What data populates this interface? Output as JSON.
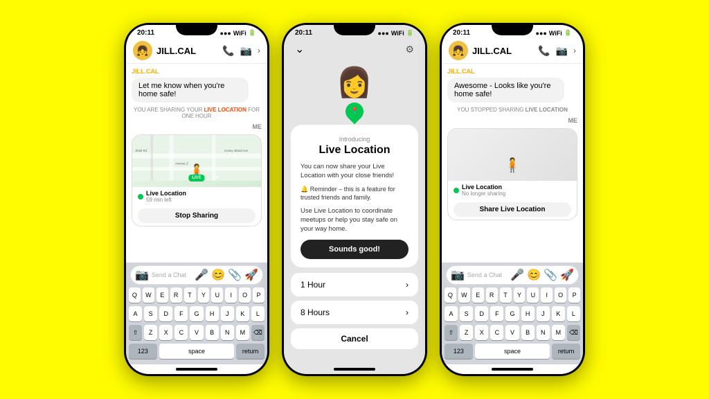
{
  "background": "#FFFC00",
  "phones": [
    {
      "id": "phone-left",
      "statusBar": {
        "time": "20:11",
        "signal": "●●●",
        "wifi": "WiFi",
        "battery": "▮▮▮"
      },
      "header": {
        "name": "JILL.CAL",
        "avatar": "👧"
      },
      "senderLabel": "JILL.CAL",
      "message": "Let me know when you're home safe!",
      "sharingLabel": "YOU ARE SHARING YOUR",
      "sharingHighlight": "LIVE LOCATION",
      "sharingFor": "FOR ONE HOUR",
      "meLabel": "ME",
      "liveLocation": {
        "title": "Live Location",
        "subtitle": "59 min left",
        "mapLabel": "Coney Island Ave"
      },
      "stopBtn": "Stop Sharing",
      "chatPlaceholder": "Send a Chat",
      "keyboardRows": [
        [
          "Q",
          "W",
          "E",
          "R",
          "T",
          "Y",
          "U",
          "I",
          "O",
          "P"
        ],
        [
          "A",
          "S",
          "D",
          "F",
          "G",
          "H",
          "J",
          "K",
          "L"
        ],
        [
          "⇧",
          "Z",
          "X",
          "C",
          "V",
          "B",
          "N",
          "M",
          "⌫"
        ],
        [
          "123",
          "space",
          "return"
        ]
      ]
    },
    {
      "id": "phone-middle",
      "statusBar": {
        "time": "20:11"
      },
      "modal": {
        "intro": "Introducing",
        "title": "Live Location",
        "body": "You can now share your Live Location with your close friends!",
        "reminder": "🔔 Reminder – this is a feature for trusted friends and family.",
        "usage": "Use Live Location to coordinate meetups or help you stay safe on your way home.",
        "cta": "Sounds good!",
        "option1": "1 Hour",
        "option2": "8 Hours",
        "cancel": "Cancel"
      }
    },
    {
      "id": "phone-right",
      "statusBar": {
        "time": "20:11",
        "signal": "●●●",
        "wifi": "WiFi",
        "battery": "▮▮▮"
      },
      "header": {
        "name": "JILL.CAL",
        "avatar": "👧"
      },
      "senderLabel": "JILL.CAL",
      "message": "Awesome - Looks like you're home safe!",
      "sharingLabel": "YOU STOPPED SHARING",
      "sharingHighlight": "LIVE LOCATION",
      "sharingFor": "",
      "meLabel": "ME",
      "liveLocation": {
        "title": "Live Location",
        "subtitle": "No longer sharing"
      },
      "shareBtn": "Share Live Location",
      "chatPlaceholder": "Send a Chat",
      "keyboardRows": [
        [
          "Q",
          "W",
          "E",
          "R",
          "T",
          "Y",
          "U",
          "I",
          "O",
          "P"
        ],
        [
          "A",
          "S",
          "D",
          "F",
          "G",
          "H",
          "J",
          "K",
          "L"
        ],
        [
          "⇧",
          "Z",
          "X",
          "C",
          "V",
          "B",
          "N",
          "M",
          "⌫"
        ],
        [
          "123",
          "space",
          "return"
        ]
      ]
    }
  ]
}
